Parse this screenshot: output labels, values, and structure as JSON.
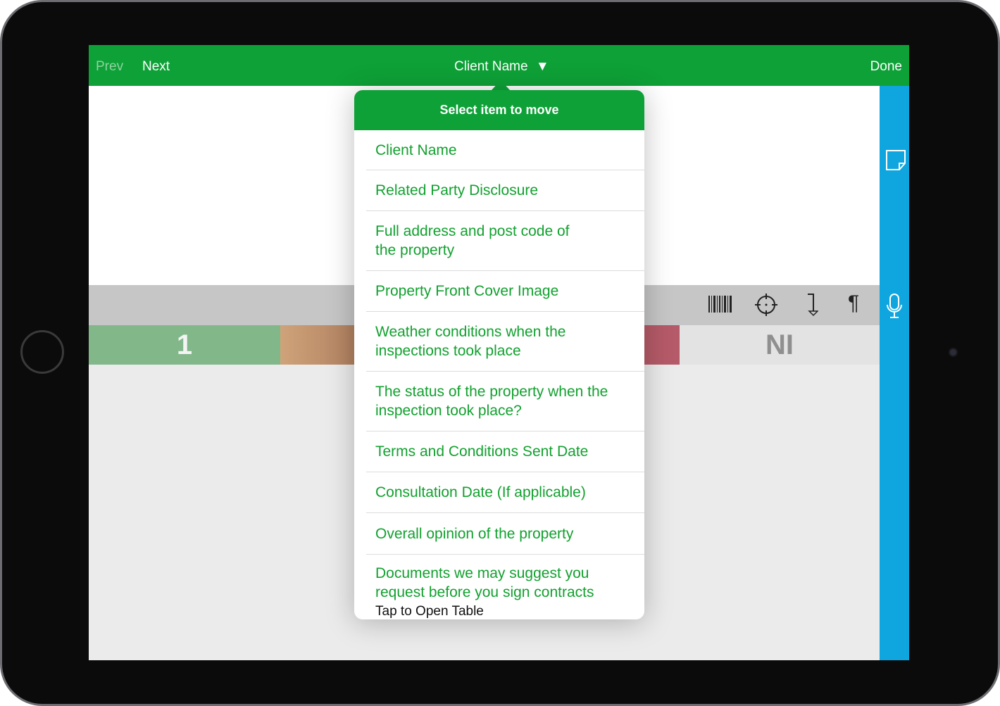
{
  "toolbar": {
    "prev": "Prev",
    "next": "Next",
    "title": "Client Name",
    "title_caret": "▼",
    "done": "Done"
  },
  "popup": {
    "header": "Select item to move",
    "items": [
      {
        "label": "Client Name"
      },
      {
        "label": "Related Party Disclosure"
      },
      {
        "label": "Full address and post code of the property"
      },
      {
        "label": "Property Front Cover Image"
      },
      {
        "label": "Weather conditions when the inspections took place"
      },
      {
        "label": "The status of the property when the inspection took place?"
      },
      {
        "label": "Terms and Conditions Sent Date"
      },
      {
        "label": "Consultation Date (If applicable)"
      },
      {
        "label": "Overall opinion of the property"
      },
      {
        "label": "Documents we may suggest you request before you sign contracts",
        "subtitle": "Tap to Open Table"
      }
    ]
  },
  "rating": {
    "cells": [
      {
        "label": "1",
        "color": "#82b78a"
      },
      {
        "label": "",
        "color": "#cfa37a"
      },
      {
        "label": "",
        "color": "#b55a68"
      },
      {
        "label": "NI",
        "color": "#e3e3e3"
      }
    ]
  },
  "tools": {
    "barcode": "barcode-icon",
    "crosshair": "crosshair-icon",
    "arrow": "arrow-down-icon",
    "paragraph": "¶"
  },
  "colors": {
    "toolbar": "#0ea137",
    "sidebar": "#0fa5de",
    "item_text": "#12a12f"
  }
}
